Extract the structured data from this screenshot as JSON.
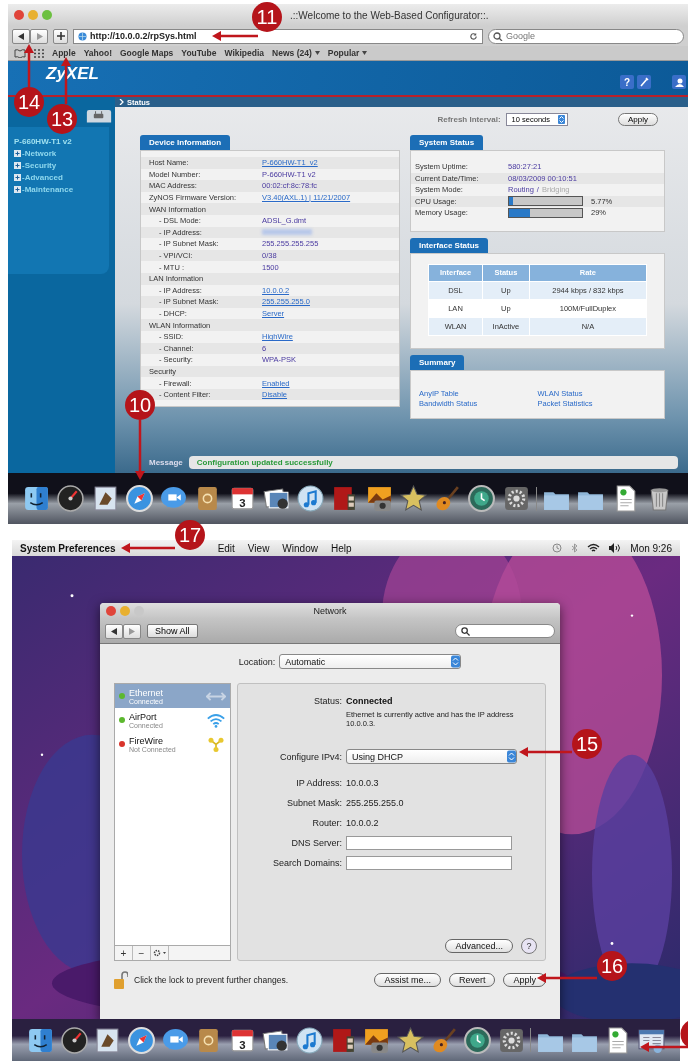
{
  "browser": {
    "title": ".::Welcome to the Web-Based Configurator::.",
    "url": "http://10.0.0.2/rpSys.html",
    "search_placeholder": "Google",
    "bookmarks": [
      {
        "label": "Apple",
        "menu": false
      },
      {
        "label": "Yahoo!",
        "menu": false
      },
      {
        "label": "Google Maps",
        "menu": false
      },
      {
        "label": "YouTube",
        "menu": false
      },
      {
        "label": "Wikipedia",
        "menu": false
      },
      {
        "label": "News (24)",
        "menu": true
      },
      {
        "label": "Popular",
        "menu": true
      }
    ]
  },
  "router": {
    "logo": "ZyXEL",
    "help_glyph": "?",
    "model": "P-660HW-T1 v2",
    "nav": [
      "-Network",
      "-Security",
      "-Advanced",
      "-Maintenance"
    ],
    "breadcrumb": "Status",
    "refresh_label": "Refresh Interval:",
    "refresh_value": "10 seconds",
    "apply": "Apply",
    "device_info": {
      "title": "Device Information",
      "rows": [
        {
          "kind": "field",
          "label": "Host Name:",
          "value": "P-660HW-T1_v2",
          "link": true
        },
        {
          "kind": "field",
          "label": "Model Number:",
          "value": "P-660HW-T1 v2",
          "link": false
        },
        {
          "kind": "field",
          "label": "MAC Address:",
          "value": "00:02:cf:8c:78:fc",
          "link": false
        },
        {
          "kind": "field",
          "label": "ZyNOS Firmware Version:",
          "value": "V3.40(AXL.1) | 11/21/2007",
          "link": true
        },
        {
          "kind": "section",
          "label": "WAN Information"
        },
        {
          "kind": "subfield",
          "label": "- DSL Mode:",
          "value": "ADSL_G.dmt",
          "link": false
        },
        {
          "kind": "subfield",
          "label": "- IP Address:",
          "redacted": true
        },
        {
          "kind": "subfield",
          "label": "- IP Subnet Mask:",
          "value": "255.255.255.255",
          "link": false
        },
        {
          "kind": "subfield",
          "label": "- VPI/VCI:",
          "value": "0/38",
          "link": false
        },
        {
          "kind": "subfield",
          "label": "- MTU :",
          "value": "1500",
          "link": false
        },
        {
          "kind": "section",
          "label": "LAN Information"
        },
        {
          "kind": "subfield",
          "label": "- IP Address:",
          "value": "10.0.0.2",
          "link": true
        },
        {
          "kind": "subfield",
          "label": "- IP Subnet Mask:",
          "value": "255.255.255.0",
          "link": true
        },
        {
          "kind": "subfield",
          "label": "- DHCP:",
          "value": "Server",
          "link": true
        },
        {
          "kind": "section",
          "label": "WLAN Information"
        },
        {
          "kind": "subfield",
          "label": "- SSID:",
          "value": "HighWire",
          "link": true
        },
        {
          "kind": "subfield",
          "label": "- Channel:",
          "value": "6",
          "link": false
        },
        {
          "kind": "subfield",
          "label": "- Security:",
          "value": "WPA-PSK",
          "link": false
        },
        {
          "kind": "section",
          "label": "Security"
        },
        {
          "kind": "subfield",
          "label": "- Firewall:",
          "value": "Enabled",
          "link": true
        },
        {
          "kind": "subfield",
          "label": "- Content Filter:",
          "value": "Disable",
          "link": true
        }
      ]
    },
    "system_status": {
      "title": "System Status",
      "rows": [
        {
          "kind": "text",
          "label": "System Uptime:",
          "value": "580:27:21"
        },
        {
          "kind": "text",
          "label": "Current Date/Time:",
          "value": "08/03/2009   00:10:51"
        },
        {
          "kind": "modes",
          "label": "System Mode:",
          "separator": "/",
          "modes": [
            {
              "label": "Routing",
              "selected": true
            },
            {
              "label": "Bridging",
              "selected": false
            }
          ]
        },
        {
          "kind": "meter",
          "label": "CPU Usage:",
          "level": 0.0577,
          "reading": "5.77%"
        },
        {
          "kind": "meter",
          "label": "Memory Usage:",
          "level": 0.29,
          "reading": "29%"
        }
      ]
    },
    "interface_status": {
      "title": "Interface Status",
      "columns": [
        "Interface",
        "Status",
        "Rate"
      ],
      "rows": [
        [
          "DSL",
          "Up",
          "2944 kbps / 832 kbps"
        ],
        [
          "LAN",
          "Up",
          "100M/FullDuplex"
        ],
        [
          "WLAN",
          "InActive",
          "N/A"
        ]
      ]
    },
    "summary": {
      "title": "Summary",
      "links": [
        "AnyIP Table",
        "WLAN Status",
        "Bandwidth Status",
        "Packet Statistics"
      ]
    },
    "message_label": "Message",
    "message": "Configuration updated successfully"
  },
  "top_dock": {
    "calendar_day": "3"
  },
  "menubar": {
    "app": "System Preferences",
    "items": [
      "Edit",
      "View",
      "Window",
      "Help"
    ],
    "clock": "Mon 9:26"
  },
  "network": {
    "title": "Network",
    "show_all": "Show All",
    "location_label": "Location:",
    "location": "Automatic",
    "services": [
      {
        "name": "Ethernet",
        "status": "Connected",
        "color": "#5cb82e",
        "kind": "ethernet",
        "selected": true
      },
      {
        "name": "AirPort",
        "status": "Connected",
        "color": "#5cb82e",
        "kind": "wifi",
        "selected": false
      },
      {
        "name": "FireWire",
        "status": "Not Connected",
        "color": "#d9342b",
        "kind": "firewire",
        "selected": false
      }
    ],
    "status_label": "Status:",
    "status": "Connected",
    "status_note": "Ethernet is currently active and has the IP address 10.0.0.3.",
    "configure_label": "Configure IPv4:",
    "configure": "Using DHCP",
    "fields": [
      {
        "kind": "text",
        "label": "IP Address:",
        "value": "10.0.0.3"
      },
      {
        "kind": "text",
        "label": "Subnet Mask:",
        "value": "255.255.255.0"
      },
      {
        "kind": "text",
        "label": "Router:",
        "value": "10.0.0.2"
      },
      {
        "kind": "input",
        "label": "DNS Server:"
      },
      {
        "kind": "input",
        "label": "Search Domains:"
      }
    ],
    "list_buttons": [
      "+",
      "−"
    ],
    "advanced": "Advanced...",
    "help": "?",
    "lock_text": "Click the lock to prevent further changes.",
    "buttons": [
      "Assist me...",
      "Revert",
      "Apply"
    ]
  },
  "bottom_dock": {
    "calendar_day": "3"
  },
  "callouts": [
    {
      "label": "11"
    },
    {
      "label": "14"
    },
    {
      "label": "13"
    },
    {
      "label": "10"
    },
    {
      "label": "17"
    },
    {
      "label": "15"
    },
    {
      "label": "16"
    }
  ]
}
